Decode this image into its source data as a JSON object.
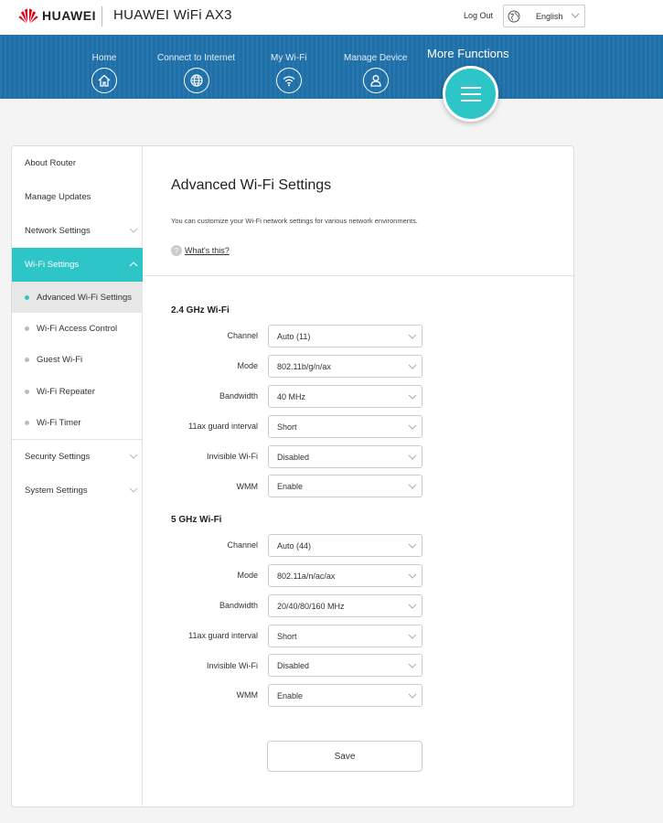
{
  "header": {
    "brand": "HUAWEI",
    "product": "HUAWEI WiFi AX3",
    "logout": "Log Out",
    "language": "English"
  },
  "nav": {
    "items": [
      {
        "label": "Home",
        "icon": "home-icon"
      },
      {
        "label": "Connect to Internet",
        "icon": "globe-icon"
      },
      {
        "label": "My Wi-Fi",
        "icon": "wifi-icon"
      },
      {
        "label": "Manage Device",
        "icon": "user-icon"
      }
    ],
    "more_label": "More Functions",
    "more_icon": "menu-icon"
  },
  "sidebar": {
    "items": [
      {
        "label": "About Router"
      },
      {
        "label": "Manage Updates"
      },
      {
        "label": "Network Settings"
      },
      {
        "label": "Wi-Fi Settings"
      },
      {
        "label": "Security Settings"
      },
      {
        "label": "System Settings"
      }
    ],
    "subitems": [
      {
        "label": "Advanced Wi-Fi Settings"
      },
      {
        "label": "Wi-Fi Access Control"
      },
      {
        "label": "Guest Wi-Fi"
      },
      {
        "label": "Wi-Fi Repeater"
      },
      {
        "label": "Wi-Fi Timer"
      }
    ]
  },
  "main": {
    "title": "Advanced Wi-Fi Settings",
    "description": "You can customize your Wi-Fi network settings for various network environments.",
    "whats_this": "What's this?",
    "band24": {
      "title": "2.4 GHz Wi-Fi",
      "rows": [
        {
          "label": "Channel",
          "value": "Auto (11)"
        },
        {
          "label": "Mode",
          "value": "802.11b/g/n/ax"
        },
        {
          "label": "Bandwidth",
          "value": "40 MHz"
        },
        {
          "label": "11ax guard interval",
          "value": "Short"
        },
        {
          "label": "Invisible Wi-Fi",
          "value": "Disabled"
        },
        {
          "label": "WMM",
          "value": "Enable"
        }
      ]
    },
    "band5": {
      "title": "5 GHz Wi-Fi",
      "rows": [
        {
          "label": "Channel",
          "value": "Auto (44)"
        },
        {
          "label": "Mode",
          "value": "802.11a/n/ac/ax"
        },
        {
          "label": "Bandwidth",
          "value": "20/40/80/160 MHz"
        },
        {
          "label": "11ax guard interval",
          "value": "Short"
        },
        {
          "label": "Invisible Wi-Fi",
          "value": "Disabled"
        },
        {
          "label": "WMM",
          "value": "Enable"
        }
      ]
    },
    "save_label": "Save"
  },
  "colors": {
    "accent": "#2ec5c9",
    "nav_bg": "#1f70a8",
    "brand_red": "#e60012"
  }
}
